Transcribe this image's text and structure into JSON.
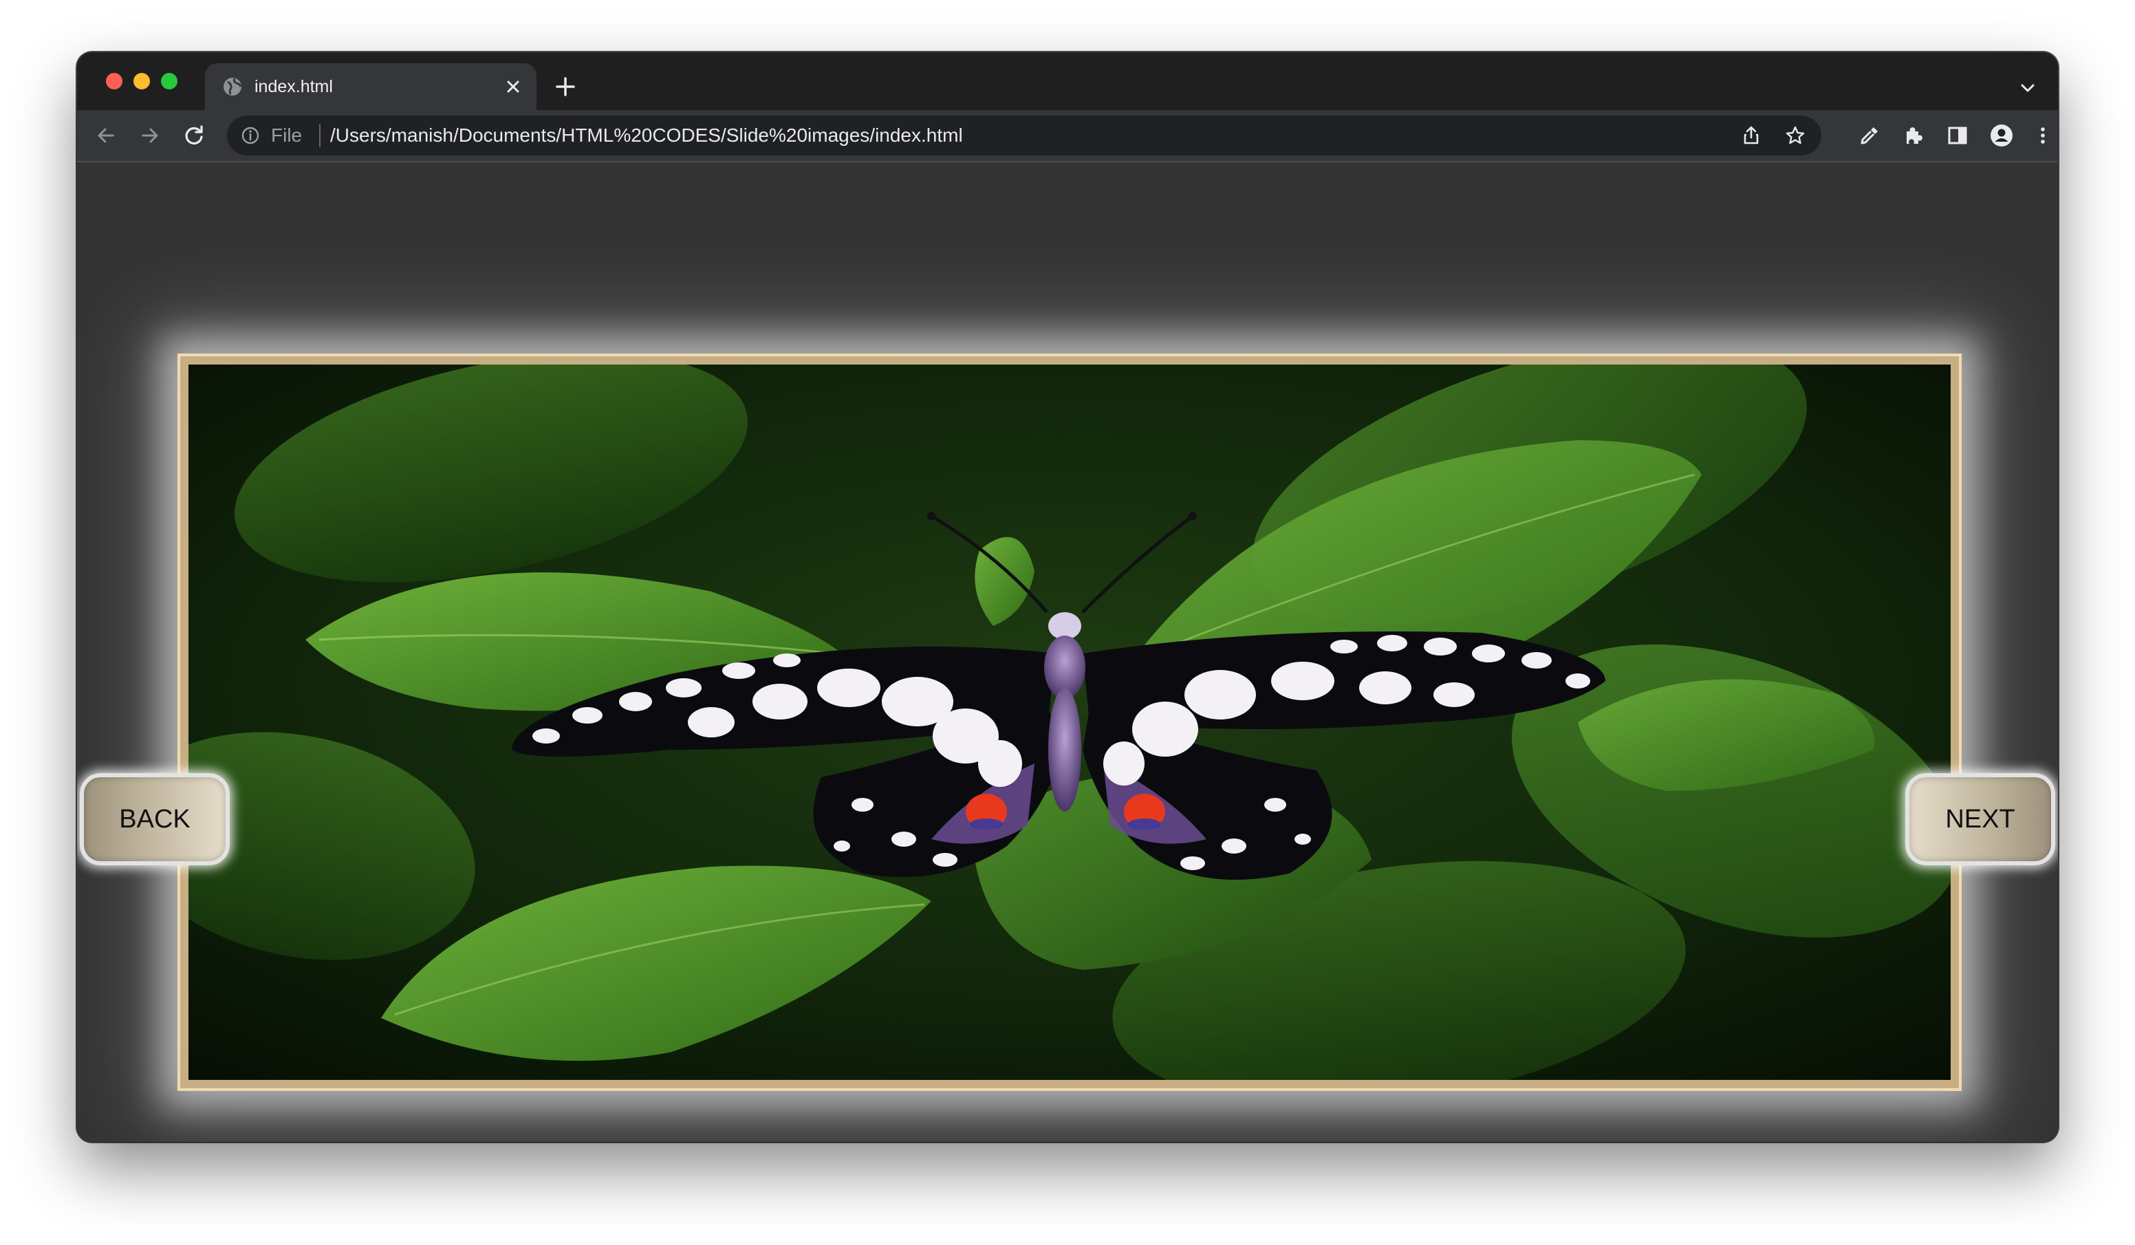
{
  "browser": {
    "tab_title": "index.html",
    "url_scheme": "File",
    "url": "/Users/manish/Documents/HTML%20CODES/Slide%20images/index.html"
  },
  "icons": {
    "tab": "globe-icon",
    "close": "close-icon",
    "new_tab": "plus-icon",
    "tab_search": "chevron-down-icon",
    "back": "back-arrow-icon",
    "forward": "forward-arrow-icon",
    "reload": "reload-icon",
    "site_info": "info-icon",
    "share": "share-icon",
    "bookmark": "star-icon",
    "eyedropper": "eyedropper-icon",
    "extensions": "puzzle-icon",
    "side_panel": "side-panel-icon",
    "profile": "profile-icon",
    "menu": "kebab-menu-icon"
  },
  "slider": {
    "image_subject": "black and white butterfly on green leaves",
    "back_label": "BACK",
    "next_label": "NEXT"
  },
  "colors": {
    "page_background": "#333333",
    "frame_border": "#c7ae84",
    "button_gradient_dark": "#9d927c",
    "button_gradient_light": "#e5ddca"
  }
}
